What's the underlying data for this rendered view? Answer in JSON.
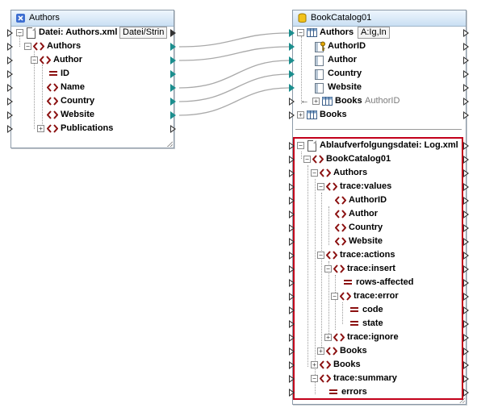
{
  "source": {
    "title": "Authors",
    "icon": "xml-schema-icon",
    "root_label": "Datei: Authors.xml",
    "root_field": "Datei/Strin",
    "items": [
      {
        "label": "Authors"
      },
      {
        "label": "Author"
      },
      {
        "label": "ID"
      },
      {
        "label": "Name"
      },
      {
        "label": "Country"
      },
      {
        "label": "Website"
      },
      {
        "label": "Publications"
      }
    ]
  },
  "target": {
    "title": "BookCatalog01",
    "icon": "database-icon",
    "authors_label": "Authors",
    "authors_field": "A:Ig,In",
    "authors_fields": [
      {
        "label": "AuthorID"
      },
      {
        "label": "Author"
      },
      {
        "label": "Country"
      },
      {
        "label": "Website"
      }
    ],
    "books_child_label": "Books",
    "books_child_hint": "AuthorID",
    "books_label": "Books",
    "trace": {
      "root_label": "Ablaufverfolgungsdatei: Log.xml",
      "catalog": "BookCatalog01",
      "authors": "Authors",
      "trace_values": "trace:values",
      "values": [
        "AuthorID",
        "Author",
        "Country",
        "Website"
      ],
      "trace_actions": "trace:actions",
      "trace_insert": "trace:insert",
      "rows_affected": "rows-affected",
      "trace_error": "trace:error",
      "code": "code",
      "state": "state",
      "trace_ignore": "trace:ignore",
      "books_inner": "Books",
      "books_outer": "Books",
      "trace_summary": "trace:summary",
      "errors": "errors"
    }
  },
  "colors": {
    "element_icon": "#8b1010",
    "connector": "#a9a9a9",
    "port_teal": "#1b8e8e",
    "highlight_frame": "#c3001a",
    "title_bar": "#c9dff3"
  }
}
